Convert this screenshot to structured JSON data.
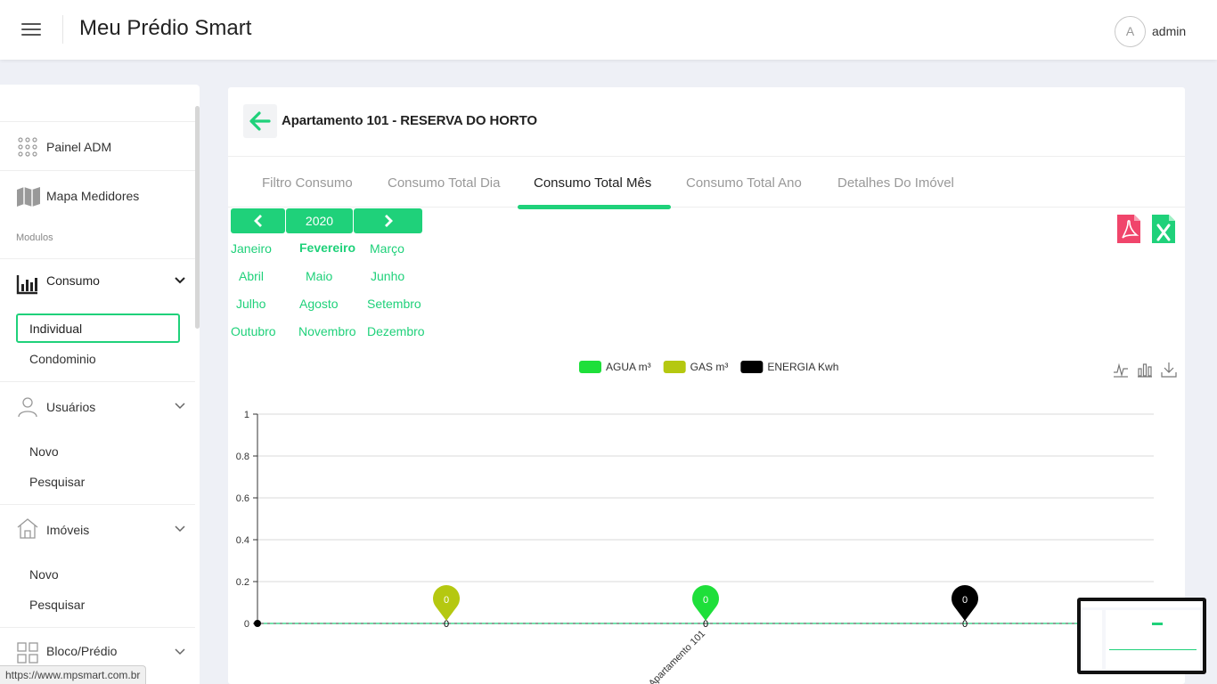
{
  "app": {
    "title": "Meu Prédio Smart",
    "user_initial": "A",
    "user_name": "admin"
  },
  "sidebar": {
    "items": [
      {
        "label": "Painel ADM",
        "icon": "grid-dots-icon"
      },
      {
        "label": "Mapa Medidores",
        "icon": "map-icon"
      }
    ],
    "section_label": "Modulos",
    "consumo": {
      "label": "Consumo",
      "icon": "bar-chart-icon",
      "sub": [
        "Individual",
        "Condominio"
      ]
    },
    "usuarios": {
      "label": "Usuários",
      "icon": "user-icon",
      "sub": [
        "Novo",
        "Pesquisar"
      ]
    },
    "imoveis": {
      "label": "Imóveis",
      "icon": "house-icon",
      "sub": [
        "Novo",
        "Pesquisar"
      ]
    },
    "bloco": {
      "label": "Bloco/Prédio",
      "icon": "blocks-icon"
    }
  },
  "card": {
    "title": "Apartamento 101 - RESERVA DO HORTO",
    "tabs": [
      "Filtro Consumo",
      "Consumo Total Dia",
      "Consumo Total Mês",
      "Consumo Total Ano",
      "Detalhes Do Imóvel"
    ],
    "active_tab": "Consumo Total Mês"
  },
  "month_picker": {
    "year": "2020",
    "months": [
      "Janeiro",
      "Fevereiro",
      "Março",
      "Abril",
      "Maio",
      "Junho",
      "Julho",
      "Agosto",
      "Setembro",
      "Outubro",
      "Novembro",
      "Dezembro"
    ],
    "selected": "Fevereiro"
  },
  "exports": {
    "pdf_icon": "pdf-icon",
    "excel_icon": "excel-icon"
  },
  "colors": {
    "accent": "#1fd17a",
    "agua": "#1edf3a",
    "gas": "#b5c810",
    "energia": "#000000"
  },
  "chart_data": {
    "type": "bar",
    "categories": [
      "Apartamento 101"
    ],
    "series": [
      {
        "name": "AGUA m³",
        "values": [
          0
        ],
        "color": "#1edf3a"
      },
      {
        "name": "GAS m³",
        "values": [
          0
        ],
        "color": "#b5c810"
      },
      {
        "name": "ENERGIA Kwh",
        "values": [
          0
        ],
        "color": "#000000"
      }
    ],
    "markpoints": [
      {
        "series": "GAS m³",
        "label": "0"
      },
      {
        "series": "AGUA m³",
        "label": "0"
      },
      {
        "series": "ENERGIA Kwh",
        "label": "0"
      }
    ],
    "y_ticks": [
      "0",
      "0.2",
      "0.4",
      "0.6",
      "0.8",
      "1"
    ],
    "ylim": [
      0,
      1
    ],
    "point_labels": [
      "0",
      "0",
      "0"
    ],
    "grid": true,
    "legend_position": "top"
  },
  "status_url": "https://www.mpsmart.com.br"
}
